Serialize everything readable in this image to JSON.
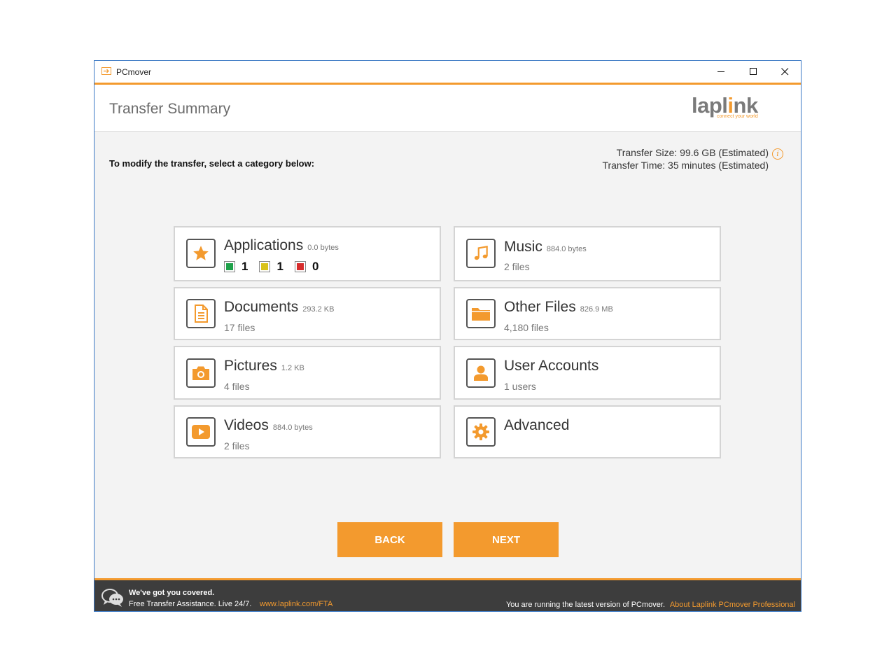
{
  "window": {
    "title": "PCmover"
  },
  "header": {
    "title": "Transfer Summary",
    "logo_text_a": "lapl",
    "logo_text_b": "i",
    "logo_text_c": "nk",
    "logo_tagline": "connect your world"
  },
  "main": {
    "instruction": "To modify the transfer, select a category below:",
    "transfer_size": "Transfer Size: 99.6 GB (Estimated)",
    "transfer_time": "Transfer Time: 35 minutes (Estimated)",
    "info_glyph": "i"
  },
  "categories": {
    "applications": {
      "name": "Applications",
      "size": "0.0 bytes",
      "icon": "star-icon",
      "status": {
        "green": "1",
        "yellow": "1",
        "red": "0"
      }
    },
    "music": {
      "name": "Music",
      "size": "884.0 bytes",
      "detail": "2 files",
      "icon": "music-note-icon"
    },
    "documents": {
      "name": "Documents",
      "size": "293.2 KB",
      "detail": "17 files",
      "icon": "document-icon"
    },
    "other_files": {
      "name": "Other Files",
      "size": "826.9 MB",
      "detail": "4,180 files",
      "icon": "folder-icon"
    },
    "pictures": {
      "name": "Pictures",
      "size": "1.2 KB",
      "detail": "4 files",
      "icon": "camera-icon"
    },
    "user_accounts": {
      "name": "User Accounts",
      "detail": "1 users",
      "icon": "user-icon"
    },
    "videos": {
      "name": "Videos",
      "size": "884.0 bytes",
      "detail": "2 files",
      "icon": "play-icon"
    },
    "advanced": {
      "name": "Advanced",
      "icon": "gear-icon"
    }
  },
  "buttons": {
    "back": "BACK",
    "next": "NEXT"
  },
  "footer": {
    "tagline": "We've got you covered.",
    "assist": "Free Transfer Assistance. Live 24/7.",
    "link": "www.laplink.com/FTA",
    "version_text": "You are running the latest version of PCmover.",
    "about": "About Laplink PCmover Professional"
  },
  "colors": {
    "accent": "#f39a2e",
    "footer_bg": "#3d3d3d",
    "window_border": "#3b78c4"
  }
}
